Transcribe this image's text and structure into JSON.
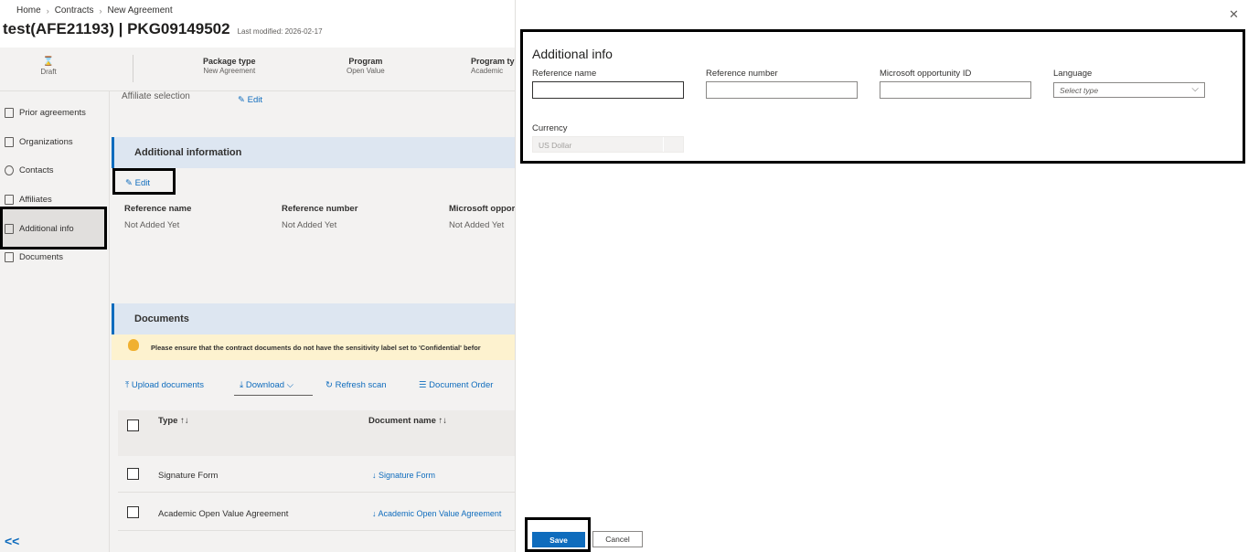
{
  "breadcrumb": {
    "items": [
      "Home",
      "Contracts",
      "New Agreement"
    ]
  },
  "header": {
    "title": "test(AFE21193) | PKG09149502",
    "last_modified": "Last modified: 2026-02-17"
  },
  "summary": {
    "status": "Draft",
    "columns": [
      {
        "key": "Package type",
        "value": "New Agreement"
      },
      {
        "key": "Program",
        "value": "Open Value"
      },
      {
        "key": "Program ty",
        "value": "Academic"
      }
    ]
  },
  "sidebar": {
    "items": [
      {
        "label": "Prior agreements",
        "icon": "prior-agreements-icon"
      },
      {
        "label": "Organizations",
        "icon": "organizations-icon"
      },
      {
        "label": "Contacts",
        "icon": "contacts-icon"
      },
      {
        "label": "Affiliates",
        "icon": "affiliates-icon"
      },
      {
        "label": "Additional info",
        "icon": "additional-info-icon",
        "active": true
      },
      {
        "label": "Documents",
        "icon": "documents-icon"
      }
    ],
    "collapse_glyph": "<<"
  },
  "affiliate": {
    "label": "Affiliate selection",
    "edit": "Edit"
  },
  "additional_info_section": {
    "title": "Additional information",
    "edit": "Edit",
    "fields": [
      {
        "label": "Reference name",
        "value": "Not Added Yet"
      },
      {
        "label": "Reference number",
        "value": "Not Added Yet"
      },
      {
        "label": "Microsoft oppor",
        "value": "Not Added Yet"
      }
    ]
  },
  "documents_section": {
    "title": "Documents",
    "warning": "Please ensure that the contract documents do not have the sensitivity label set to 'Confidential' befor",
    "toolbar": {
      "upload": "Upload documents",
      "download": "Download",
      "refresh": "Refresh scan",
      "order": "Document Order"
    },
    "columns": [
      "Type ↑↓",
      "Document name ↑↓"
    ],
    "rows": [
      {
        "type": "Signature Form",
        "name": "Signature Form"
      },
      {
        "type": "Academic Open Value Agreement",
        "name": "Academic Open Value Agreement"
      }
    ]
  },
  "panel": {
    "close_glyph": "✕",
    "title": "Additional info",
    "fields": {
      "reference_name": {
        "label": "Reference name",
        "value": ""
      },
      "reference_number": {
        "label": "Reference number",
        "value": ""
      },
      "opportunity_id": {
        "label": "Microsoft opportunity ID",
        "value": ""
      },
      "language": {
        "label": "Language",
        "placeholder": "Select type"
      },
      "currency": {
        "label": "Currency",
        "value": "US Dollar"
      }
    },
    "buttons": {
      "save": "Save",
      "cancel": "Cancel"
    }
  },
  "colors": {
    "accent": "#0f6cbd",
    "warning_bg": "#fdf2cf",
    "section_bg": "#dde6f1"
  }
}
